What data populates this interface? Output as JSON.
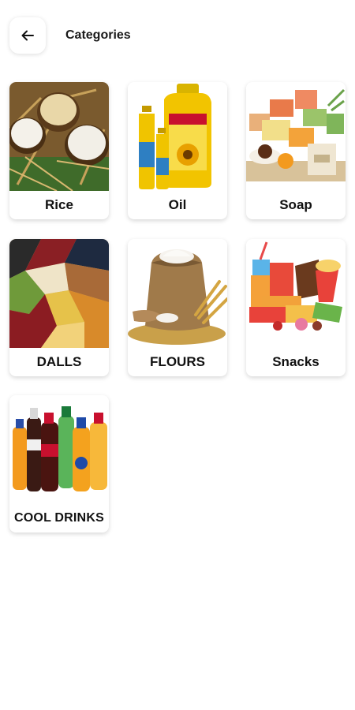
{
  "header": {
    "title": "Categories",
    "back_icon": "arrow-left-icon"
  },
  "categories": [
    {
      "label": "Rice",
      "image": "rice-bowls-image"
    },
    {
      "label": "Oil",
      "image": "oil-bottles-image"
    },
    {
      "label": "Soap",
      "image": "soap-bars-image"
    },
    {
      "label": "DALLS",
      "image": "dals-pulses-image"
    },
    {
      "label": "FLOURS",
      "image": "flour-sack-image"
    },
    {
      "label": "Snacks",
      "image": "snacks-image"
    },
    {
      "label": "COOL DRINKS",
      "image": "cool-drinks-image"
    }
  ],
  "colors": {
    "background": "#ffffff",
    "text": "#111111"
  }
}
